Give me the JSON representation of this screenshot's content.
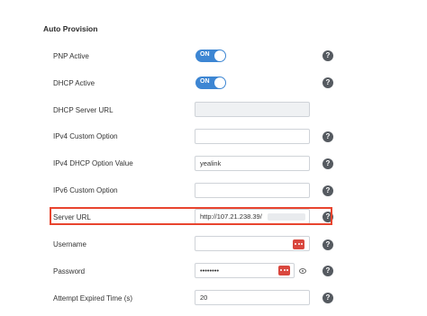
{
  "section": {
    "title": "Auto Provision"
  },
  "fields": {
    "pnp_active": {
      "label": "PNP Active",
      "toggle": "ON"
    },
    "dhcp_active": {
      "label": "DHCP Active",
      "toggle": "ON"
    },
    "dhcp_server_url": {
      "label": "DHCP Server URL",
      "value": ""
    },
    "ipv4_custom_option": {
      "label": "IPv4 Custom Option",
      "value": ""
    },
    "ipv4_dhcp_option_value": {
      "label": "IPv4 DHCP Option Value",
      "value": "yealink"
    },
    "ipv6_custom_option": {
      "label": "IPv6 Custom Option",
      "value": ""
    },
    "server_url": {
      "label": "Server URL",
      "value": "http://107.21.238.39/"
    },
    "username": {
      "label": "Username",
      "value": ""
    },
    "password": {
      "label": "Password",
      "value": "••••••••"
    },
    "attempt_expired_time": {
      "label": "Attempt Expired Time (s)",
      "value": "20"
    }
  },
  "help_icon": "?",
  "colors": {
    "toggle_on": "#3d86d3",
    "highlight": "#e8442e",
    "dots_button": "#d9473e",
    "help_icon": "#555a60"
  }
}
